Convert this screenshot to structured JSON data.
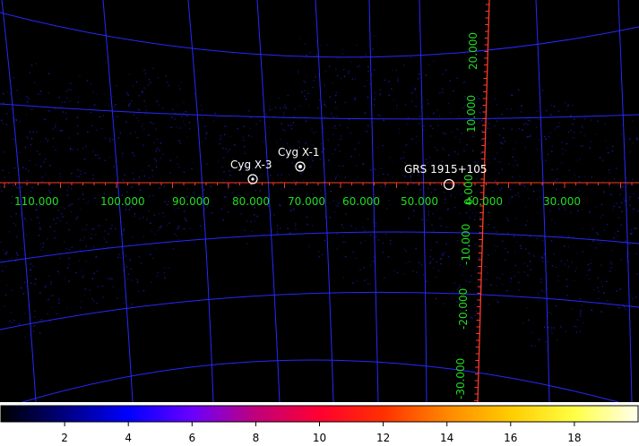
{
  "colors": {
    "background": "#000000",
    "grid": "#2828ff",
    "axis": "#ff3a2a",
    "tick_label": "#22dd22",
    "source_marker": "#ffffff",
    "exposure_noise": "#1a1aff"
  },
  "axes": {
    "longitude_labels": [
      "110.000",
      "100.000",
      "90.000",
      "80.000",
      "70.000",
      "60.000",
      "50.000",
      "40.000",
      "30.000"
    ],
    "latitude_labels": [
      "20.000",
      "10.000",
      "0.000",
      "-10.000",
      "-20.000",
      "-30.000"
    ]
  },
  "sources": [
    {
      "name": "Cyg X-3"
    },
    {
      "name": "Cyg X-1"
    },
    {
      "name": "GRS 1915+105"
    }
  ],
  "colorbar": {
    "tick_labels": [
      "2",
      "4",
      "6",
      "8",
      "10",
      "12",
      "14",
      "16",
      "18"
    ],
    "range": [
      0,
      20
    ],
    "colormap": "heat"
  }
}
